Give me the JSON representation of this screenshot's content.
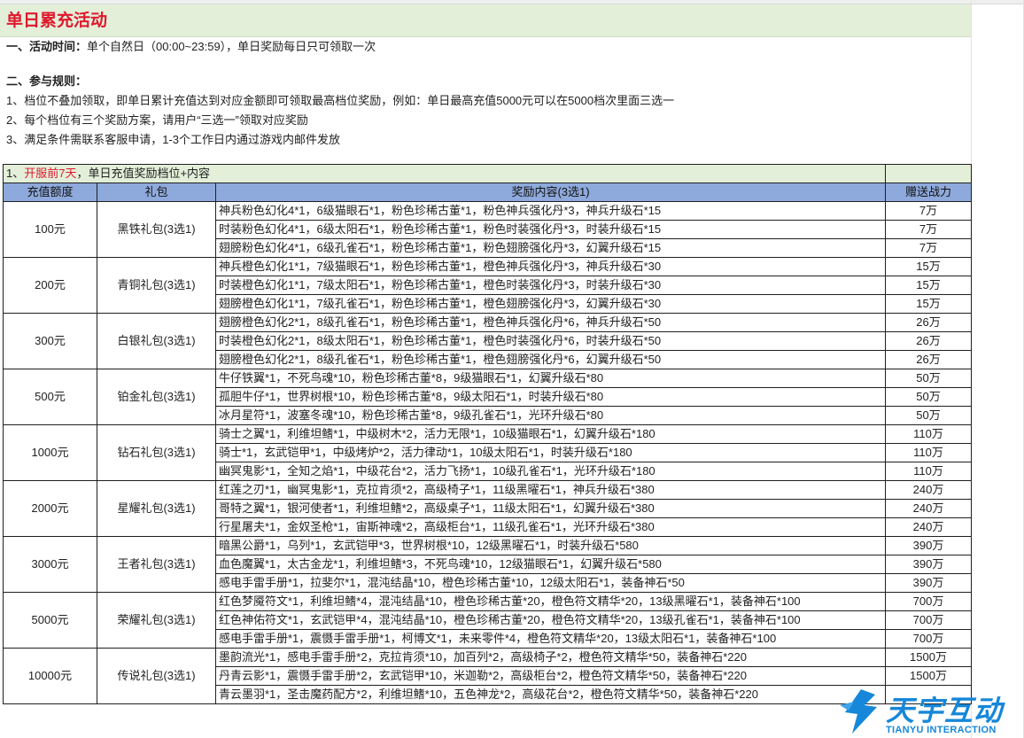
{
  "title": "单日累充活动",
  "rules": {
    "time_label": "一、活动时间：",
    "time_text": "单个自然日（00:00~23:59），单日奖励每日只可领取一次",
    "rules_label": "二、参与规则：",
    "rule_1": "1、档位不叠加领取，即单日累计充值达到对应金额即可领取最高档位奖励，例如：单日最高充值5000元可以在5000档次里面三选一",
    "rule_2": "2、每个档位有三个奖励方案，请用户“三选一”领取对应奖励",
    "rule_3": "3、满足条件需联系客服申请，1-3个工作日内通过游戏内邮件发放"
  },
  "section": {
    "prefix": "1、",
    "highlight": "开服前7天",
    "suffix": "，单日充值奖励档位+内容"
  },
  "columns": [
    "充值额度",
    "礼包",
    "奖励内容(3选1)",
    "赠送战力"
  ],
  "tiers": [
    {
      "amount": "100元",
      "pack": "黑铁礼包(3选1)",
      "options": [
        {
          "content": "神兵粉色幻化4*1，6级猫眼石*1，粉色珍稀古董*1，粉色神兵强化丹*3，神兵升级石*15",
          "power": "7万"
        },
        {
          "content": "时装粉色幻化4*1，6级太阳石*1，粉色珍稀古董*1，粉色时装强化丹*3，时装升级石*15",
          "power": "7万"
        },
        {
          "content": "翅膀粉色幻化4*1，6级孔雀石*1，粉色珍稀古董*1，粉色翅膀强化丹*3，幻翼升级石*15",
          "power": "7万"
        }
      ]
    },
    {
      "amount": "200元",
      "pack": "青铜礼包(3选1)",
      "options": [
        {
          "content": "神兵橙色幻化1*1，7级猫眼石*1，粉色珍稀古董*1，橙色神兵强化丹*3，神兵升级石*30",
          "power": "15万"
        },
        {
          "content": "时装橙色幻化1*1，7级太阳石*1，粉色珍稀古董*1，橙色时装强化丹*3，时装升级石*30",
          "power": "15万"
        },
        {
          "content": "翅膀橙色幻化1*1，7级孔雀石*1，粉色珍稀古董*1，橙色翅膀强化丹*3，幻翼升级石*30",
          "power": "15万"
        }
      ]
    },
    {
      "amount": "300元",
      "pack": "白银礼包(3选1)",
      "options": [
        {
          "content": "翅膀橙色幻化2*1，8级孔雀石*1，粉色珍稀古董*1，橙色神兵强化丹*6，神兵升级石*50",
          "power": "26万"
        },
        {
          "content": "时装橙色幻化2*1，8级太阳石*1，粉色珍稀古董*1，橙色时装强化丹*6，时装升级石*50",
          "power": "26万"
        },
        {
          "content": "翅膀橙色幻化2*1，8级孔雀石*1，粉色珍稀古董*1，橙色翅膀强化丹*6，幻翼升级石*50",
          "power": "26万"
        }
      ]
    },
    {
      "amount": "500元",
      "pack": "铂金礼包(3选1)",
      "options": [
        {
          "content": "牛仔铁翼*1，不死鸟魂*10，粉色珍稀古董*8，9级猫眼石*1，幻翼升级石*80",
          "power": "50万"
        },
        {
          "content": "孤胆牛仔*1，世界树根*10，粉色珍稀古董*8，9级太阳石*1，时装升级石*80",
          "power": "50万"
        },
        {
          "content": "冰月星符*1，波塞冬魂*10，粉色珍稀古董*8，9级孔雀石*1，光环升级石*80",
          "power": "50万"
        }
      ]
    },
    {
      "amount": "1000元",
      "pack": "钻石礼包(3选1)",
      "options": [
        {
          "content": "骑士之翼*1，利维坦鳍*1，中级树木*2，活力无限*1，10级猫眼石*1，幻翼升级石*180",
          "power": "110万"
        },
        {
          "content": "骑士*1，玄武铠甲*1，中级烤炉*2，活力律动*1，10级太阳石*1，时装升级石*180",
          "power": "110万"
        },
        {
          "content": "幽冥鬼影*1，全知之焰*1，中级花台*2，活力飞扬*1，10级孔雀石*1，光环升级石*180",
          "power": "110万"
        }
      ]
    },
    {
      "amount": "2000元",
      "pack": "星耀礼包(3选1)",
      "options": [
        {
          "content": "红莲之刃*1，幽冥鬼影*1，克拉肯须*2，高级椅子*1，11级黑曜石*1，神兵升级石*380",
          "power": "240万"
        },
        {
          "content": "哥特之翼*1，银河使者*1，利维坦鳍*2，高级桌子*1，11级太阳石*1，幻翼升级石*380",
          "power": "240万"
        },
        {
          "content": "行星屠夫*1，金奴圣枪*1，宙斯神魂*2，高级柜台*1，11级孔雀石*1，光环升级石*380",
          "power": "240万"
        }
      ]
    },
    {
      "amount": "3000元",
      "pack": "王者礼包(3选1)",
      "options": [
        {
          "content": "暗黑公爵*1，乌列*1，玄武铠甲*3，世界树根*10，12级黑曜石*1，时装升级石*580",
          "power": "390万"
        },
        {
          "content": "血色魔翼*1，太古金龙*1，利维坦鳍*3，不死鸟魂*10，12级猫眼石*1，幻翼升级石*580",
          "power": "390万"
        },
        {
          "content": "感电手雷手册*1，拉斐尔*1，混沌结晶*10，橙色珍稀古董*10，12级太阳石*1，装备神石*50",
          "power": "390万"
        }
      ]
    },
    {
      "amount": "5000元",
      "pack": "荣耀礼包(3选1)",
      "options": [
        {
          "content": "红色梦魇符文*1，利维坦鳍*4，混沌结晶*10，橙色珍稀古董*20，橙色符文精华*20，13级黑曜石*1，装备神石*100",
          "power": "700万"
        },
        {
          "content": "红色神佑符文*1，玄武铠甲*4，混沌结晶*10，橙色珍稀古董*20，橙色符文精华*20，13级孔雀石*1，装备神石*100",
          "power": "700万"
        },
        {
          "content": "感电手雷手册*1，震慑手雷手册*1，柯博文*1，未来零件*4，橙色符文精华*20，13级太阳石*1，装备神石*100",
          "power": "700万"
        }
      ]
    },
    {
      "amount": "10000元",
      "pack": "传说礼包(3选1)",
      "options": [
        {
          "content": "墨韵流光*1，感电手雷手册*2，克拉肯须*10，加百列*2，高级椅子*2，橙色符文精华*50，装备神石*220",
          "power": "1500万"
        },
        {
          "content": "丹青云影*1，震慑手雷手册*2，玄武铠甲*10，米迦勒*2，高级柜台*2，橙色符文精华*50，装备神石*220",
          "power": "1500万"
        },
        {
          "content": "青云墨羽*1，圣击魔药配方*2，利维坦鳍*10，五色神龙*2，高级花台*2，橙色符文精华*50，装备神石*220",
          "power": ""
        }
      ]
    }
  ],
  "watermark": {
    "name": "天宇互动",
    "sub": "TIANYU INTERACTION",
    "color": "#1687d9",
    "icon": "tianyu-logo-icon"
  }
}
